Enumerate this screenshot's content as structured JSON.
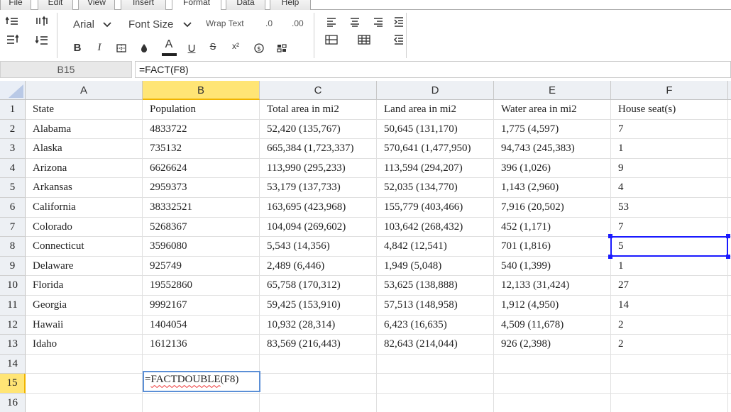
{
  "tabs": [
    "File",
    "Edit",
    "View",
    "Insert",
    "Format",
    "Data",
    "Help"
  ],
  "active_tab": "Format",
  "toolbar": {
    "font_name": "Arial",
    "font_size_label": "Font Size",
    "wrap_text_label": "Wrap Text",
    "decrease_decimal_label": ".0",
    "increase_decimal_label": ".00",
    "bold_label": "B",
    "italic_label": "I",
    "underline_label": "U",
    "strikethrough_label": "S",
    "font_color_label": "A",
    "superscript_label": "x²"
  },
  "formula_bar": {
    "name_box": "B15",
    "formula": "=FACT(F8)"
  },
  "sheet": {
    "columns": [
      "A",
      "B",
      "C",
      "D",
      "E",
      "F"
    ],
    "rows": [
      [
        "State",
        "Population",
        "Total area in mi2",
        "Land area in mi2",
        "Water area in mi2",
        "House seat(s)"
      ],
      [
        "Alabama",
        "4833722",
        "52,420 (135,767)",
        "50,645 (131,170)",
        "1,775 (4,597)",
        "7"
      ],
      [
        "Alaska",
        "735132",
        "665,384 (1,723,337)",
        "570,641 (1,477,950)",
        "94,743 (245,383)",
        "1"
      ],
      [
        "Arizona",
        "6626624",
        "113,990 (295,233)",
        "113,594 (294,207)",
        "396 (1,026)",
        "9"
      ],
      [
        "Arkansas",
        "2959373",
        "53,179 (137,733)",
        "52,035 (134,770)",
        "1,143 (2,960)",
        "4"
      ],
      [
        "California",
        "38332521",
        "163,695 (423,968)",
        "155,779 (403,466)",
        "7,916 (20,502)",
        "53"
      ],
      [
        "Colorado",
        "5268367",
        "104,094 (269,602)",
        "103,642 (268,432)",
        "452 (1,171)",
        "7"
      ],
      [
        "Connecticut",
        "3596080",
        "5,543 (14,356)",
        "4,842 (12,541)",
        "701 (1,816)",
        "5"
      ],
      [
        "Delaware",
        "925749",
        "2,489 (6,446)",
        "1,949 (5,048)",
        "540 (1,399)",
        "1"
      ],
      [
        "Florida",
        "19552860",
        "65,758 (170,312)",
        "53,625 (138,888)",
        "12,133 (31,424)",
        "27"
      ],
      [
        "Georgia",
        "9992167",
        "59,425 (153,910)",
        "57,513 (148,958)",
        "1,912 (4,950)",
        "14"
      ],
      [
        "Hawaii",
        "1404054",
        "10,932 (28,314)",
        "6,423 (16,635)",
        "4,509 (11,678)",
        "2"
      ],
      [
        "Idaho",
        "1612136",
        "83,569 (216,443)",
        "82,643 (214,044)",
        "926 (2,398)",
        "2"
      ],
      [
        "",
        "",
        "",
        "",
        "",
        ""
      ],
      [
        "",
        "",
        "",
        "",
        "",
        ""
      ],
      [
        "",
        "",
        "",
        "",
        "",
        ""
      ]
    ],
    "row_numbers": [
      "1",
      "2",
      "3",
      "4",
      "5",
      "6",
      "7",
      "8",
      "9",
      "10",
      "11",
      "12",
      "13",
      "14",
      "15",
      "16"
    ],
    "selected_column": "B",
    "selected_row": "15",
    "active_cell": "F8",
    "editing_cell": "B15",
    "editor_text_prefix": "=",
    "editor_text_fn": "FACTDOUBLE",
    "editor_text_suffix": "(F8)"
  },
  "colors": {
    "selection_blue": "#1a1aff",
    "header_highlight": "#ffe575",
    "editor_border": "#5b8fd6"
  }
}
